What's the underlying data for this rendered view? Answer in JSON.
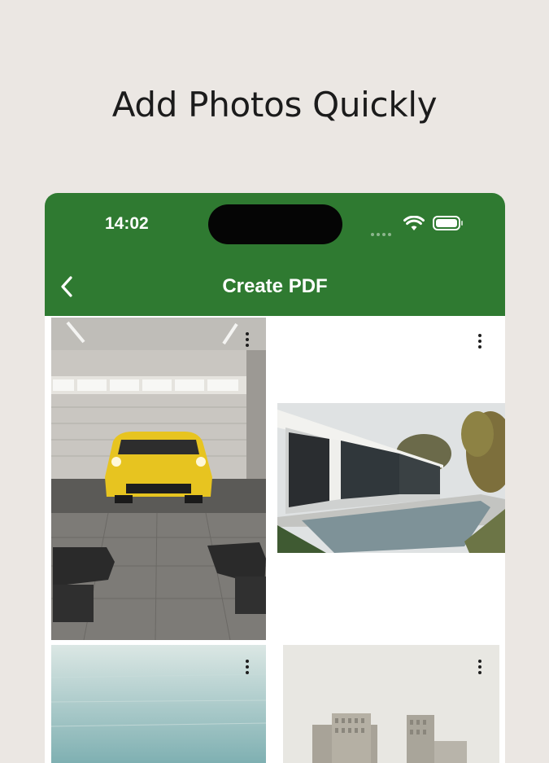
{
  "headline": "Add Photos Quickly",
  "status_bar": {
    "time": "14:02",
    "icons": [
      "cellular-signal-icon",
      "wifi-icon",
      "battery-icon"
    ]
  },
  "app_bar": {
    "title": "Create PDF",
    "back_icon": "chevron-left-icon",
    "background": "#2f7a31"
  },
  "photos": [
    {
      "subject": "yellow sports car in garage",
      "menu_icon": "more-vertical-icon"
    },
    {
      "subject": "modern house with pool",
      "menu_icon": "more-vertical-icon"
    },
    {
      "subject": "water surface",
      "menu_icon": "more-vertical-icon"
    },
    {
      "subject": "city buildings",
      "menu_icon": "more-vertical-icon"
    }
  ]
}
